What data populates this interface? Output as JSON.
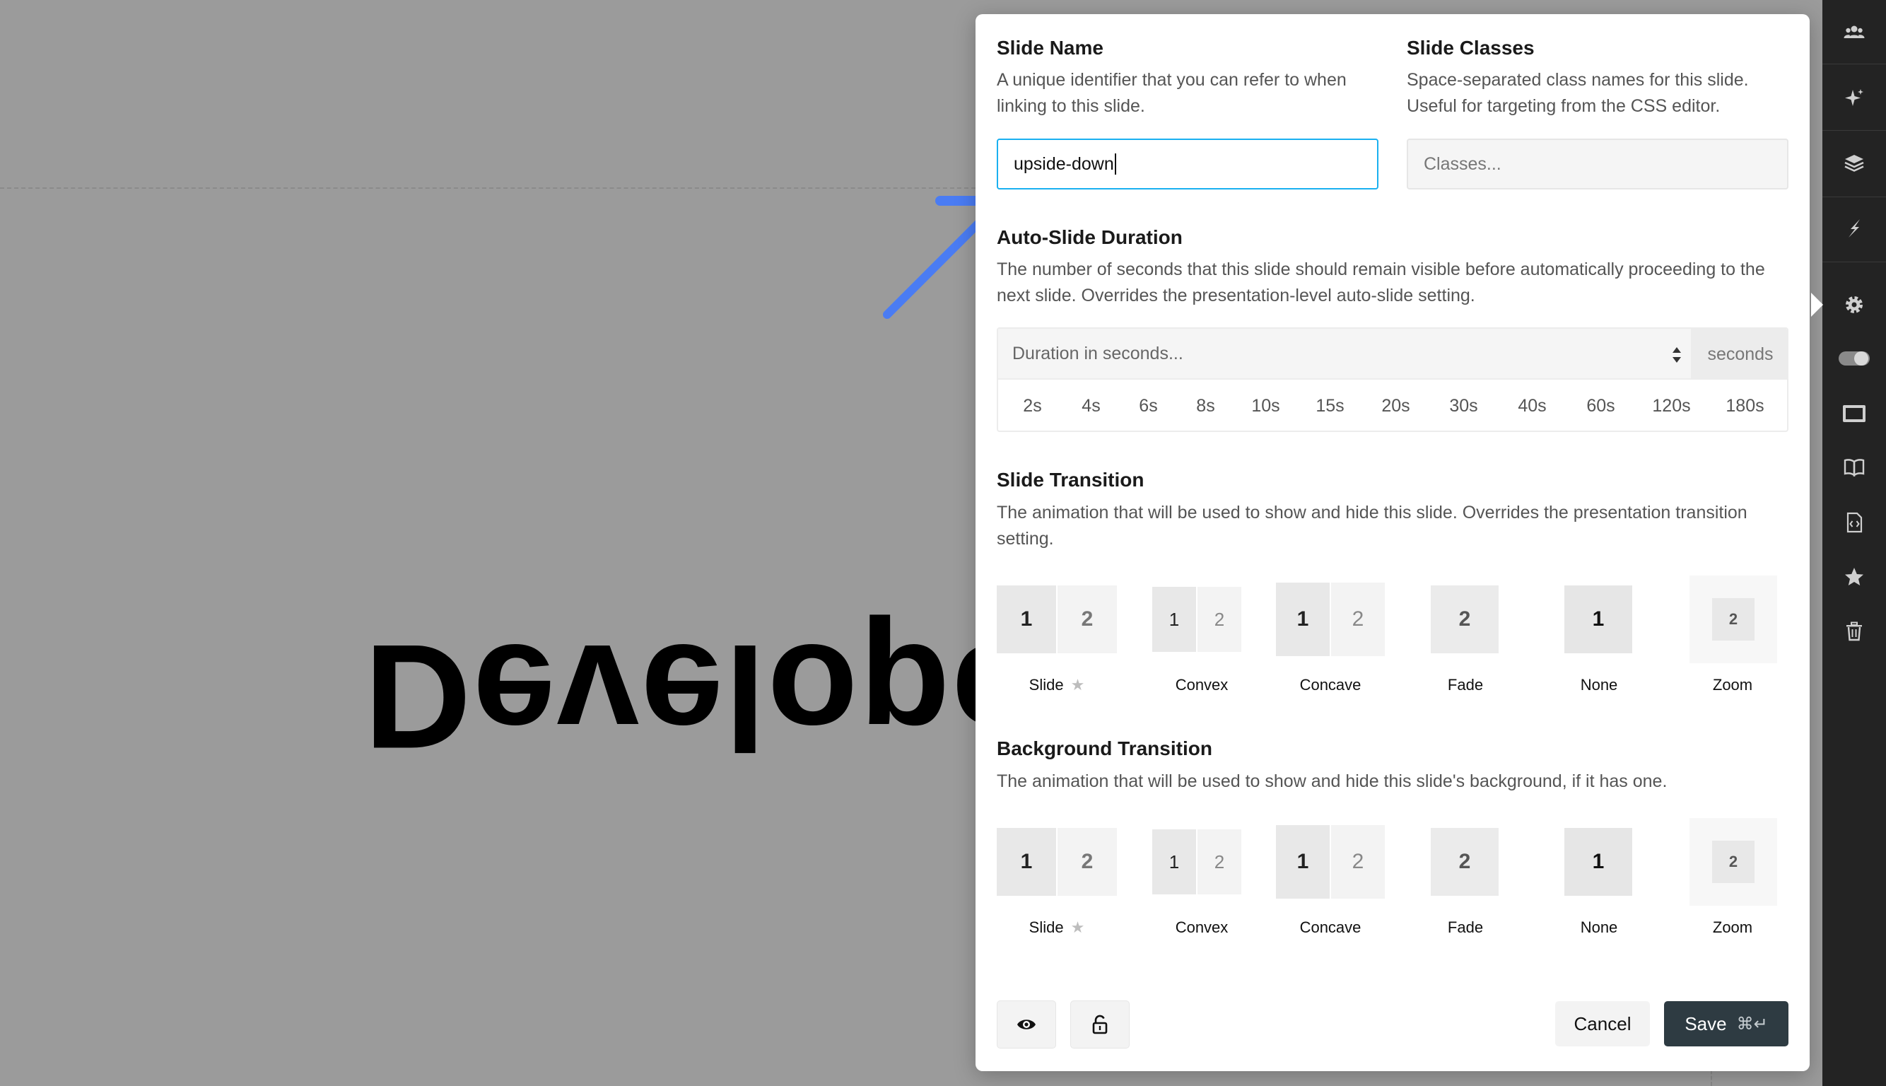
{
  "canvas": {
    "slide_text": "Developer M"
  },
  "dialog": {
    "slide_name": {
      "title": "Slide Name",
      "description": "A unique identifier that you can refer to when linking to this slide.",
      "value": "upside-down"
    },
    "slide_classes": {
      "title": "Slide Classes",
      "description": "Space-separated class names for this slide. Useful for targeting from the CSS editor.",
      "placeholder": "Classes..."
    },
    "auto_slide": {
      "title": "Auto-Slide Duration",
      "description": "The number of seconds that this slide should remain visible before automatically proceeding to the next slide. Overrides the presentation-level auto-slide setting.",
      "placeholder": "Duration in seconds...",
      "unit": "seconds",
      "presets": [
        "2s",
        "4s",
        "6s",
        "8s",
        "10s",
        "15s",
        "20s",
        "30s",
        "40s",
        "60s",
        "120s",
        "180s"
      ]
    },
    "slide_transition": {
      "title": "Slide Transition",
      "description": "The animation that will be used to show and hide this slide. Overrides the presentation transition setting.",
      "options": [
        "Slide",
        "Convex",
        "Concave",
        "Fade",
        "None",
        "Zoom"
      ]
    },
    "background_transition": {
      "title": "Background Transition",
      "description": "The animation that will be used to show and hide this slide's background, if it has one.",
      "options": [
        "Slide",
        "Convex",
        "Concave",
        "Fade",
        "None",
        "Zoom"
      ]
    },
    "tile_digits": {
      "one": "1",
      "two": "2"
    },
    "footer": {
      "cancel_label": "Cancel",
      "save_label": "Save",
      "save_shortcut": "⌘↵"
    }
  },
  "sidebar": {
    "items": [
      "users-icon",
      "sparkle-icon",
      "layers-icon",
      "lightning-icon",
      "gear-icon",
      "toggle-icon",
      "slide-frame-icon",
      "book-icon",
      "code-file-icon",
      "star-icon",
      "trash-icon"
    ]
  },
  "colors": {
    "accent": "#1ab0f0",
    "save_button": "#2e3b42",
    "sidebar": "#232323",
    "arrow": "#4a7cf3"
  }
}
